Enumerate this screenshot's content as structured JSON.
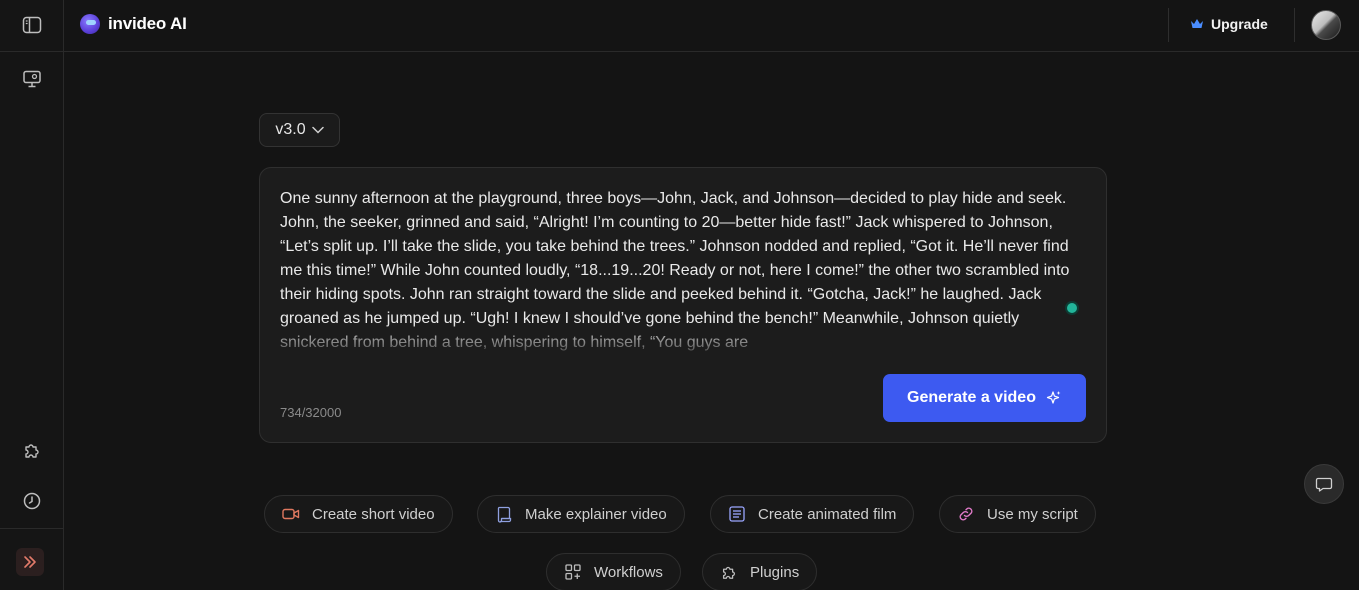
{
  "app": {
    "brand": "invideo AI"
  },
  "sidebar": {
    "top_icon": "sidebar-toggle-icon",
    "items": [
      {
        "icon": "monitor-icon"
      },
      {
        "icon": "puzzle-icon"
      },
      {
        "icon": "clock-icon"
      }
    ],
    "expand_icon": "double-chevron-right-icon"
  },
  "header": {
    "upgrade_label": "Upgrade",
    "upgrade_icon": "crown-icon"
  },
  "version": {
    "label": "v3.0"
  },
  "prompt": {
    "text": "One sunny afternoon at the playground, three boys—John, Jack, and Johnson—decided to play hide and seek. John, the seeker, grinned and said, “Alright! I’m counting to 20—better hide fast!” Jack whispered to Johnson, “Let’s split up. I’ll take the slide, you take behind the trees.” Johnson nodded and replied, “Got it. He’ll never find me this time!” While John counted loudly, “18...19...20! Ready or not, here I come!” the other two scrambled into their hiding spots. John ran straight toward the slide and peeked behind it. “Gotcha, Jack!” he laughed. Jack groaned as he jumped up. “Ugh! I knew I should’ve gone behind the bench!” Meanwhile, Johnson quietly snickered from behind a tree, whispering to himself, “You guys are",
    "counter": "734/32000",
    "generate_label": "Generate a video"
  },
  "chips": [
    {
      "label": "Create short video",
      "icon": "video-camera-icon"
    },
    {
      "label": "Make explainer video",
      "icon": "scroll-icon"
    },
    {
      "label": "Create animated film",
      "icon": "list-document-icon"
    },
    {
      "label": "Use my script",
      "icon": "link-icon"
    },
    {
      "label": "Workflows",
      "icon": "grid-plus-icon"
    },
    {
      "label": "Plugins",
      "icon": "puzzle-icon"
    }
  ],
  "colors": {
    "accent": "#3d5af1",
    "background": "#141414",
    "status_dot": "#22b59a",
    "chip_video_icon": "#e0785f",
    "chip_explainer_icon": "#8fa0e0",
    "chip_film_icon": "#9aa6ff",
    "chip_script_icon": "#e07ac8"
  }
}
